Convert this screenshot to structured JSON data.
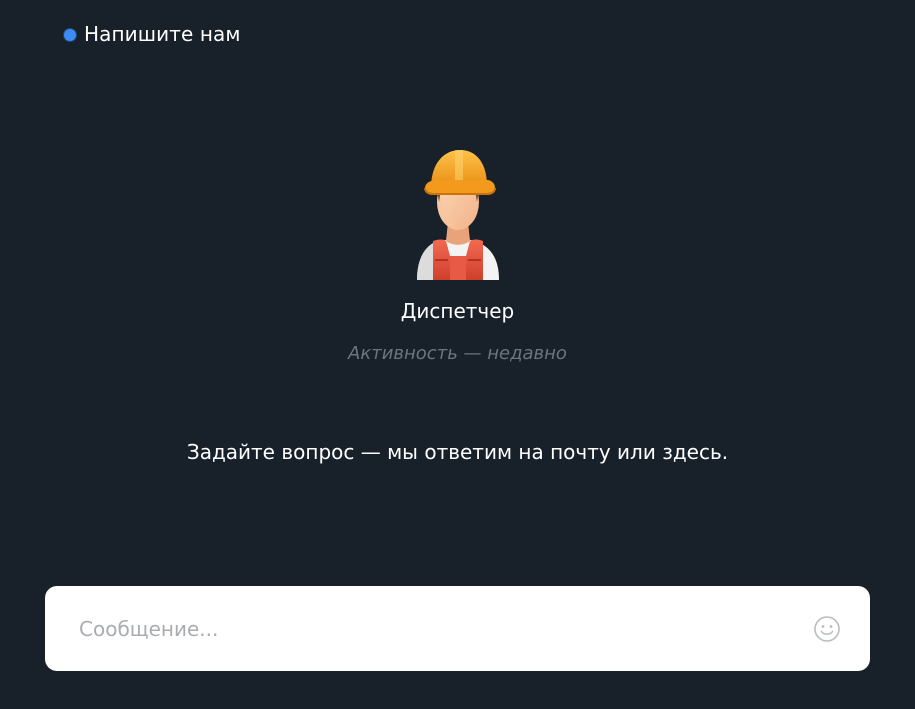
{
  "header": {
    "title": "Напишите нам",
    "status_color": "#3b8cf5"
  },
  "agent": {
    "avatar_icon": "construction-worker-avatar",
    "name": "Диспетчер",
    "status": "Активность — недавно"
  },
  "greeting": "Задайте вопрос — мы ответим на почту или здесь.",
  "composer": {
    "placeholder": "Сообщение...",
    "emoji_icon": "smiley-icon"
  },
  "colors": {
    "background": "#18202a",
    "text": "#ffffff",
    "muted": "#6d747d",
    "accent": "#3b8cf5",
    "hardhat": "#f4a224",
    "vest": "#e5533d"
  }
}
